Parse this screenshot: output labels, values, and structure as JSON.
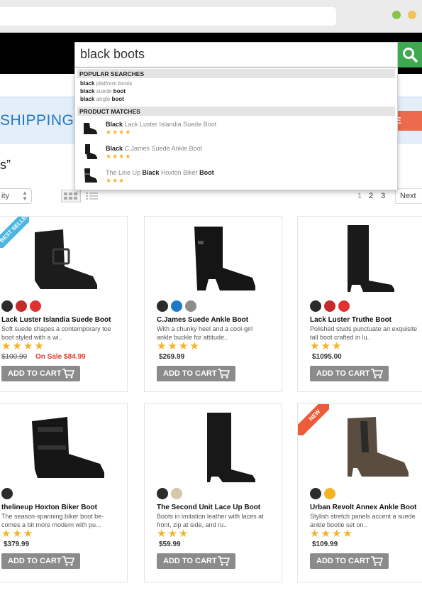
{
  "search": {
    "query": "black boots"
  },
  "promo": {
    "text": "SHIPPING C",
    "button": "E"
  },
  "results_title": "s”",
  "toolbar": {
    "sort_label": "ity",
    "pages": [
      "1",
      "2",
      "3"
    ],
    "next": "Next"
  },
  "autocomplete": {
    "popular_header": "POPULAR SEARCHES",
    "popular": [
      {
        "bold": "black",
        "rest": " platform boots"
      },
      {
        "bold": "black",
        "rest": " suede ",
        "bold2": "boot"
      },
      {
        "bold": "black",
        "rest": " angle ",
        "bold2": "boot"
      }
    ],
    "products_header": "PRODUCT MATCHES",
    "products": [
      {
        "pre": "",
        "bold": "Black",
        "post": " Lack Luster Islandia Suede Boot",
        "bold2": "",
        "rating": 4
      },
      {
        "pre": "",
        "bold": "Black",
        "post": " C.James Suede Ankle Boot",
        "bold2": "",
        "rating": 4
      },
      {
        "pre": "The Line Up ",
        "bold": "Black",
        "post": " Hoxton Biker ",
        "bold2": "Boot",
        "rating": 3
      }
    ]
  },
  "products": [
    {
      "name": "Lack Luster Islandia Suede Boot",
      "desc1": "Soft suede shapes a contemporary toe",
      "desc2": "boot styled with a wi..",
      "old_price": "$100.99",
      "sale": "On Sale $84.99",
      "price": "",
      "rating": 4,
      "swatches": [
        "#2b2b2b",
        "#c62a2a",
        "#e0332f"
      ],
      "ribbon": "BEST SELLER",
      "ribbon_color": "#4bb6e0",
      "cart": "ADD TO CART"
    },
    {
      "name": "C.James Suede Ankle Boot",
      "desc1": "With a chunky heel and a cool-girl",
      "desc2": "ankle buckle for attitude..",
      "old_price": "",
      "sale": "",
      "price": "$269.99",
      "rating": 4,
      "swatches": [
        "#2b2b2b",
        "#1f79c8",
        "#8c8c8c"
      ],
      "ribbon": "",
      "ribbon_color": "",
      "cart": "ADD TO CART"
    },
    {
      "name": "Lack Luster Truthe Boot",
      "desc1": "Polished studs punctuate an exquisite",
      "desc2": "tall boot crafted in lu..",
      "old_price": "",
      "sale": "",
      "price": "$1095.00",
      "rating": 3,
      "swatches": [
        "#2b2b2b",
        "#c62a2a",
        "#e0332f"
      ],
      "ribbon": "",
      "ribbon_color": "",
      "cart": "ADD TO CART"
    },
    {
      "name": "thelineup Hoxton Biker Boot",
      "desc1": "The season-spanning biker boot be-",
      "desc2": "comes a bit more modern with pu...",
      "old_price": "",
      "sale": "",
      "price": "$379.99",
      "rating": 3,
      "swatches": [
        "#2b2b2b"
      ],
      "ribbon": "",
      "ribbon_color": "",
      "cart": "ADD TO CART"
    },
    {
      "name": "The Second Unit Lace Up Boot",
      "desc1": "Boots in imitation leather with laces at",
      "desc2": "front, zip at side, and ru..",
      "old_price": "",
      "sale": "",
      "price": "$59.99",
      "rating": 3,
      "swatches": [
        "#2b2b2b",
        "#d5c8a9"
      ],
      "ribbon": "",
      "ribbon_color": "",
      "cart": "ADD TO CART"
    },
    {
      "name": "Urban Revolt Annex Ankle Boot",
      "desc1": "Stylish stretch panels accent a suede",
      "desc2": "ankle bootie set on..",
      "old_price": "",
      "sale": "",
      "price": "$109.99",
      "rating": 4,
      "swatches": [
        "#2b2b2b",
        "#f2b327"
      ],
      "ribbon": "NEW",
      "ribbon_color": "#ec5b3a",
      "cart": "ADD TO CART"
    }
  ]
}
